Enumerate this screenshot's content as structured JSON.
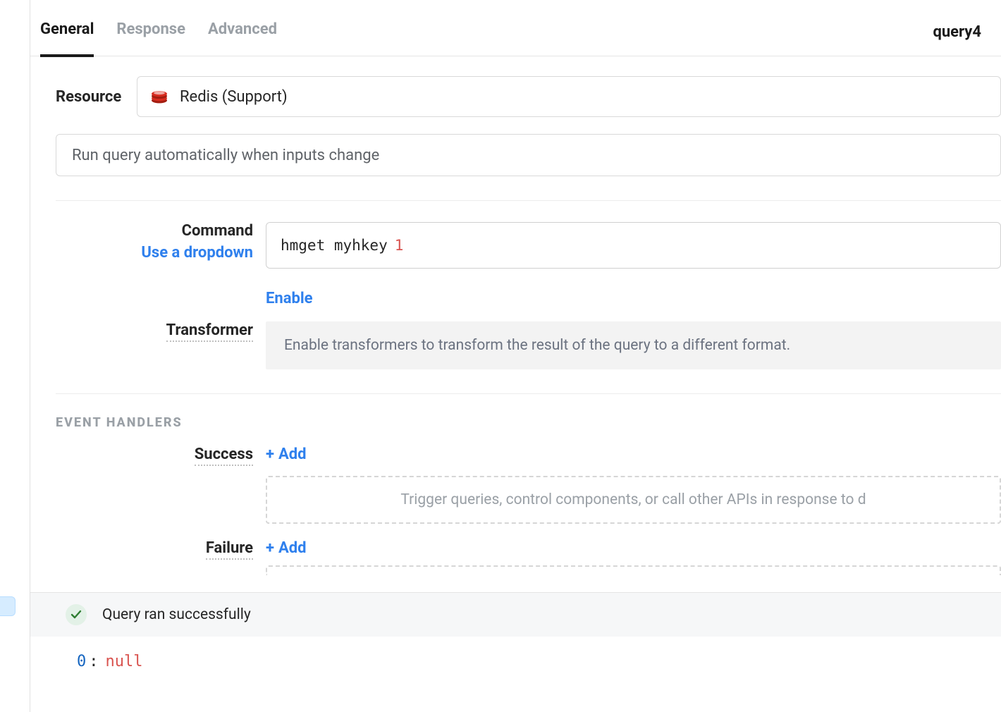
{
  "tabs": {
    "general": "General",
    "response": "Response",
    "advanced": "Advanced"
  },
  "query_name": "query4",
  "resource": {
    "label": "Resource",
    "selected": "Redis (Support)"
  },
  "run_mode": "Run query automatically when inputs change",
  "command": {
    "label": "Command",
    "dropdown_link": "Use a dropdown",
    "text": "hmget myhkey",
    "arg": "1"
  },
  "transformer": {
    "label": "Transformer",
    "enable": "Enable",
    "help": "Enable transformers to transform the result of the query to a different format."
  },
  "events": {
    "title": "Event Handlers",
    "success_label": "Success",
    "failure_label": "Failure",
    "add_label": "Add",
    "placeholder": "Trigger queries, control components, or call other APIs in response to d"
  },
  "status": {
    "message": "Query ran successfully"
  },
  "result": {
    "index": "0",
    "value": "null"
  }
}
